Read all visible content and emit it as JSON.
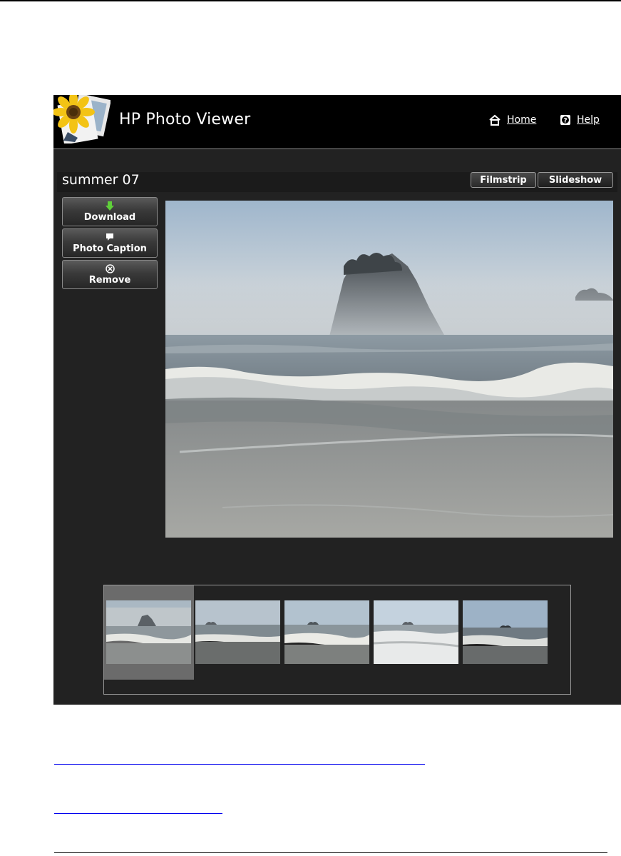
{
  "header": {
    "app_title": "HP Photo Viewer",
    "nav": {
      "home_label": "Home",
      "help_label": "Help"
    }
  },
  "album": {
    "title": "summer 07"
  },
  "view_toggle": {
    "filmstrip_label": "Filmstrip",
    "slideshow_label": "Slideshow"
  },
  "actions": {
    "download_label": "Download",
    "caption_label": "Photo Caption",
    "remove_label": "Remove"
  },
  "filmstrip": {
    "thumb_count": 5,
    "selected_index": 0
  },
  "colors": {
    "viewer_bg": "#222222",
    "header_bg": "#000000",
    "download_icon": "#5fcf3a",
    "link": "#0000ee"
  },
  "icons": [
    "home-icon",
    "help-icon",
    "download-arrow-icon",
    "caption-icon",
    "remove-icon",
    "logo-sunflower-icon"
  ]
}
